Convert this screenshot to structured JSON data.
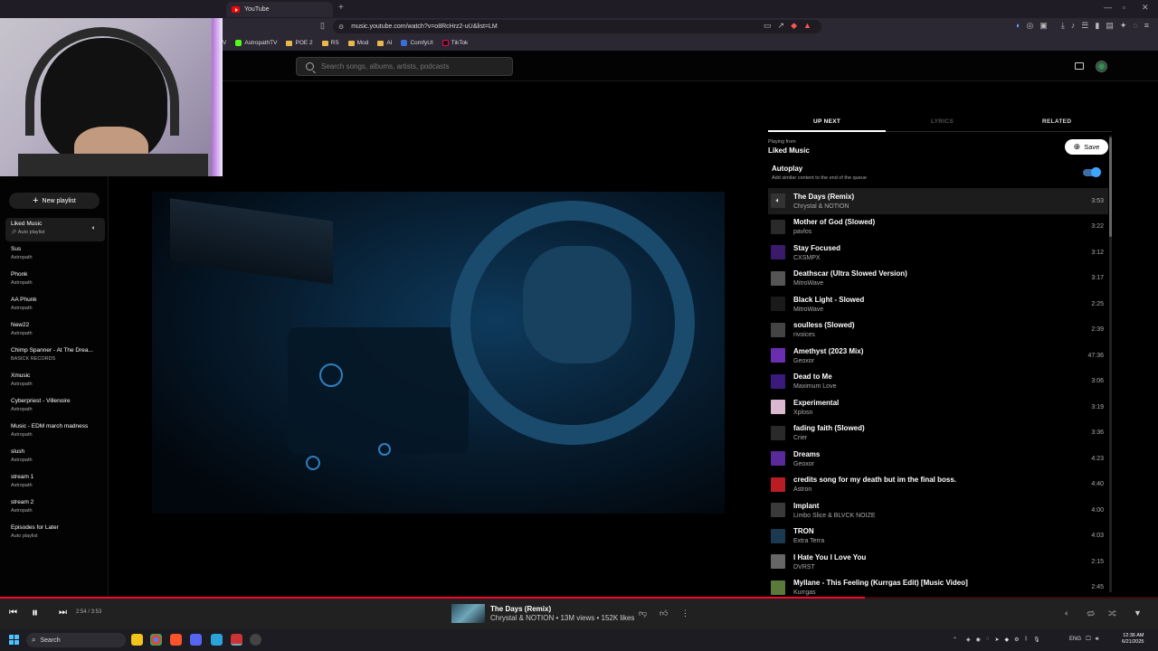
{
  "browser": {
    "tab_title": "YouTube",
    "new_tab": "+",
    "url": "music.youtube.com/watch?v=o8RcHrz2-uU&list=LM",
    "bookmarks": [
      {
        "label": "V"
      },
      {
        "label": "AstropathTV"
      },
      {
        "label": "POE 2"
      },
      {
        "label": "RS"
      },
      {
        "label": "Mod"
      },
      {
        "label": "AI"
      },
      {
        "label": "ComfyUI"
      },
      {
        "label": "TikTok"
      }
    ]
  },
  "header": {
    "search_placeholder": "Search songs, albums, artists, podcasts"
  },
  "sidebar": {
    "new_playlist": "New playlist",
    "playlists": [
      {
        "title": "Liked Music",
        "sub": "Auto playlist",
        "active": true
      },
      {
        "title": "Sus",
        "sub": "Astropath"
      },
      {
        "title": "Phonk",
        "sub": "Astropath"
      },
      {
        "title": "AA Phunk",
        "sub": "Astropath"
      },
      {
        "title": "New22",
        "sub": "Astropath"
      },
      {
        "title": "Chimp Spanner - At The Drea...",
        "sub": "BASICK RECORDS"
      },
      {
        "title": "Xmusic",
        "sub": "Astropath"
      },
      {
        "title": "Cyberpriest - Villenoire",
        "sub": "Astropath"
      },
      {
        "title": "Music - EDM march madness",
        "sub": "Astropath"
      },
      {
        "title": "slush",
        "sub": "Astropath"
      },
      {
        "title": "stream 1",
        "sub": "Astropath"
      },
      {
        "title": "stream 2",
        "sub": "Astropath"
      },
      {
        "title": "Episodes for Later",
        "sub": "Auto playlist"
      }
    ]
  },
  "panel": {
    "tabs": [
      "UP NEXT",
      "LYRICS",
      "RELATED"
    ],
    "playing_from_label": "Playing from",
    "playing_from_value": "Liked Music",
    "save": "Save",
    "autoplay_title": "Autoplay",
    "autoplay_desc": "Add similar content to the end of the queue",
    "queue": [
      {
        "title": "The Days (Remix)",
        "artist": "Chrystal & NOTION",
        "duration": "3:53",
        "thumb": "#333333"
      },
      {
        "title": "Mother of God (Slowed)",
        "artist": "pavlos",
        "duration": "3:22",
        "thumb": "#2a2a2a"
      },
      {
        "title": "Stay Focused",
        "artist": "CXSMPX",
        "duration": "3:12",
        "thumb": "#3b1a6b"
      },
      {
        "title": "Deathscar (Ultra Slowed Version)",
        "artist": "MitroWave",
        "duration": "3:17",
        "thumb": "#555555"
      },
      {
        "title": "Black Light - Slowed",
        "artist": "MitroWave",
        "duration": "2:25",
        "thumb": "#1a1a1a"
      },
      {
        "title": "soulless (Slowed)",
        "artist": "rivoices",
        "duration": "2:39",
        "thumb": "#444444"
      },
      {
        "title": "Amethyst (2023 Mix)",
        "artist": "Geoxor",
        "duration": "47:36",
        "thumb": "#6a2fb0"
      },
      {
        "title": "Dead to Me",
        "artist": "Maximum Love",
        "duration": "3:06",
        "thumb": "#3a1a7a"
      },
      {
        "title": "Experimental",
        "artist": "Xplosn",
        "duration": "3:19",
        "thumb": "#d9b8d0"
      },
      {
        "title": "fading faith (Slowed)",
        "artist": "Crier",
        "duration": "3:36",
        "thumb": "#2a2a2a"
      },
      {
        "title": "Dreams",
        "artist": "Geoxor",
        "duration": "4:23",
        "thumb": "#5a2a9a"
      },
      {
        "title": "credits song for my death but im the final boss.",
        "artist": "Astron",
        "duration": "4:40",
        "thumb": "#b81d24"
      },
      {
        "title": "Implant",
        "artist": "Limbo Slice & BLVCK NOIZE",
        "duration": "4:00",
        "thumb": "#3a3a3a"
      },
      {
        "title": "TRON",
        "artist": "Extra Terra",
        "duration": "4:03",
        "thumb": "#1b3a52"
      },
      {
        "title": "I Hate You I Love You",
        "artist": "DVRST",
        "duration": "2:15",
        "thumb": "#666666"
      },
      {
        "title": "Myllane - This Feeling (Kurrgas Edit) [Music Video]",
        "artist": "Kurrgas",
        "duration": "2:45",
        "thumb": "#5a7a3a"
      }
    ]
  },
  "player": {
    "time": "2:54 / 3:53",
    "progress_fraction": 0.747,
    "title": "The Days (Remix)",
    "meta": "Chrystal & NOTION • 13M views • 152K likes"
  },
  "taskbar": {
    "search": "Search",
    "lang": "ENG",
    "time": "12:36 AM",
    "date": "6/21/2025"
  },
  "colors": {
    "accent": "#ff0033",
    "toggle": "#3ea6ff",
    "background": "#030303"
  }
}
